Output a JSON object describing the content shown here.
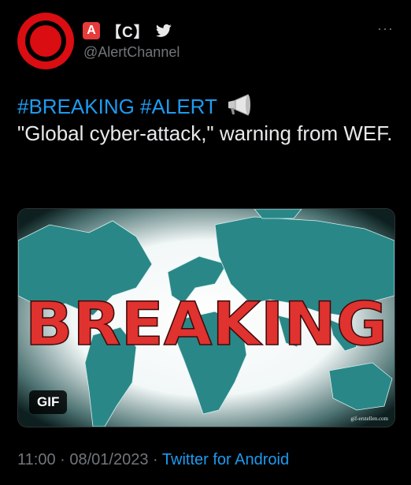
{
  "author": {
    "badge_letter": "A",
    "name_suffix": "【C】",
    "handle": "@AlertChannel",
    "verified_icon": "twitter-bird-icon"
  },
  "menu": {
    "more_label": "···"
  },
  "tweet": {
    "hashtags": "#BREAKING #ALERT",
    "body": "\"Global cyber-attack,\" warning from WEF.",
    "emoji_icon": "megaphone-icon"
  },
  "media": {
    "headline": "BREAKING",
    "badge": "GIF",
    "watermark": "gif-erstellen.com"
  },
  "footer": {
    "time": "11:00",
    "separator": "·",
    "date": "08/01/2023",
    "source": "Twitter for Android"
  },
  "colors": {
    "link": "#1d9bf0",
    "avatar_red": "#d90d12",
    "headline_red": "#e0322f",
    "map_teal": "#2a8787"
  }
}
